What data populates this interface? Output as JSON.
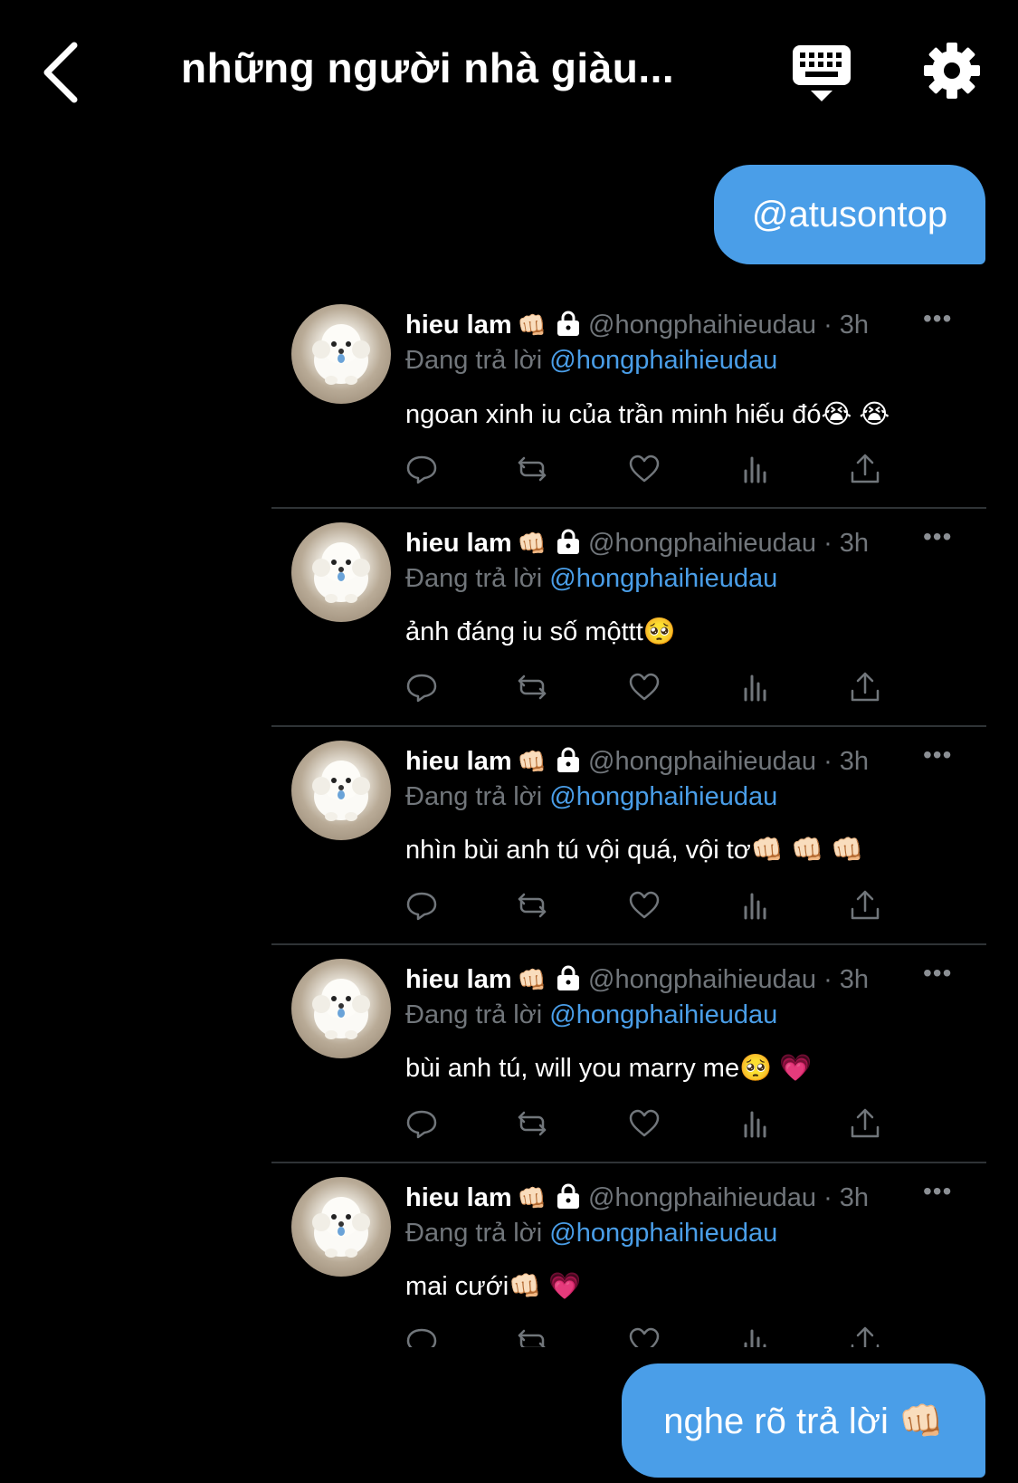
{
  "header": {
    "title": "những người nhà giàu..."
  },
  "messages": {
    "top": "@atusontop",
    "bottom": "nghe rõ trả lời 👊🏻"
  },
  "tweets": [
    {
      "name": "hieu lam",
      "badge": "👊🏻",
      "handle": "@hongphaihieudau · 3h",
      "reply_prefix": "Đang trả lời ",
      "reply_to": "@hongphaihieudau",
      "text": "ngoan xinh iu của trần minh hiếu đó😭 😭"
    },
    {
      "name": "hieu lam",
      "badge": "👊🏻",
      "handle": "@hongphaihieudau · 3h",
      "reply_prefix": "Đang trả lời ",
      "reply_to": "@hongphaihieudau",
      "text": "ảnh đáng iu số mộttt🥺"
    },
    {
      "name": "hieu lam",
      "badge": "👊🏻",
      "handle": "@hongphaihieudau · 3h",
      "reply_prefix": "Đang trả lời ",
      "reply_to": "@hongphaihieudau",
      "text": "nhìn bùi anh tú vội quá, vội tơ👊🏻 👊🏻 👊🏻"
    },
    {
      "name": "hieu lam",
      "badge": "👊🏻",
      "handle": "@hongphaihieudau · 3h",
      "reply_prefix": "Đang trả lời ",
      "reply_to": "@hongphaihieudau",
      "text": "bùi anh tú, will you marry me🥺 💗"
    },
    {
      "name": "hieu lam",
      "badge": "👊🏻",
      "handle": "@hongphaihieudau · 3h",
      "reply_prefix": "Đang trả lời ",
      "reply_to": "@hongphaihieudau",
      "text": "mai cưới👊🏻 💗"
    }
  ],
  "icons": {
    "back": "chevron-left-icon",
    "keyboard": "keyboard-icon",
    "settings": "gear-icon",
    "actions": [
      "reply-icon",
      "retweet-icon",
      "like-icon",
      "views-icon",
      "share-icon"
    ]
  },
  "colors": {
    "background": "#000000",
    "bubble": "#4a9ee8",
    "muted": "#71767b",
    "link": "#4a9ee8"
  }
}
